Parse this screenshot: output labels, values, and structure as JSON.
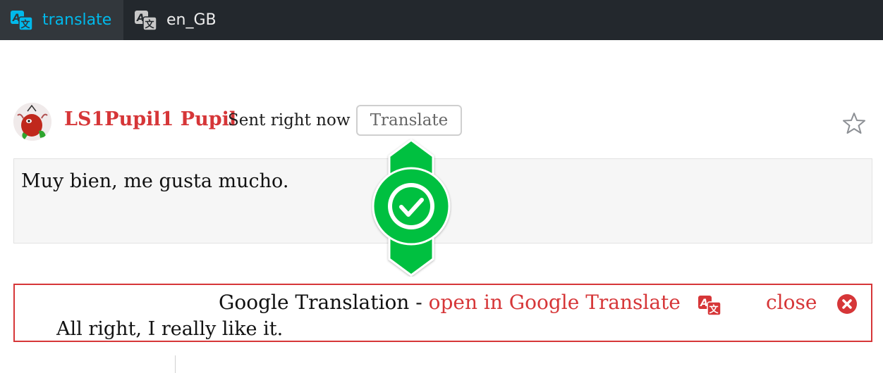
{
  "tabs": {
    "active_label": "translate",
    "locale_label": "en_GB"
  },
  "comment": {
    "author": "LS1Pupil1 Pupil",
    "sent": "Sent right now",
    "translate_button": "Translate",
    "message": "Muy bien, me gusta mucho."
  },
  "translation": {
    "title": "Google Translation",
    "separator": " - ",
    "open_link": "open in Google Translate",
    "close_label": "close",
    "text": "All right, I really like it."
  },
  "icons": {
    "tab_translate": "translate-icon",
    "star": "star-icon",
    "check": "check-badge-icon",
    "close": "close-circle-icon"
  },
  "colors": {
    "accent_red": "#d63638",
    "tab_active": "#00b9eb",
    "badge_green": "#00c040",
    "topbar": "#23282d"
  }
}
